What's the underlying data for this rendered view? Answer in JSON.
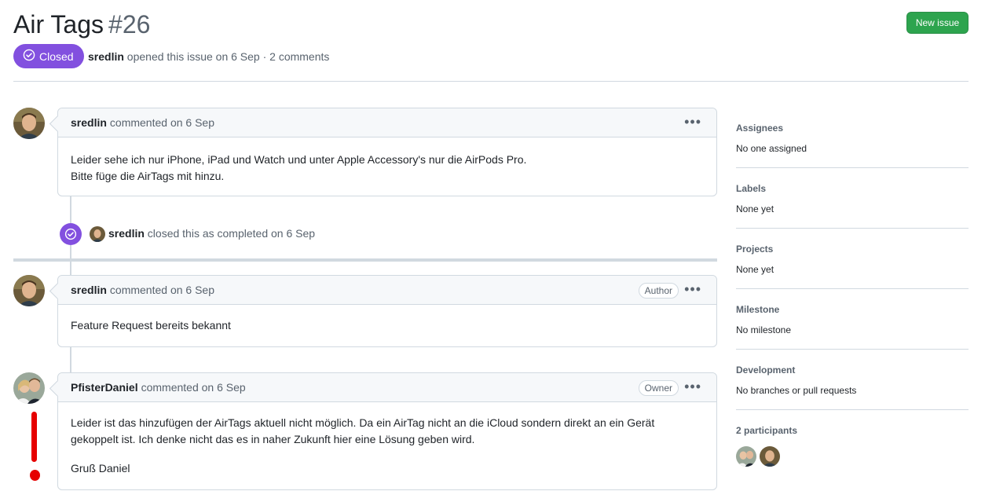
{
  "issue": {
    "title": "Air Tags",
    "number": "#26",
    "state": "Closed",
    "author": "sredlin",
    "opened_text": "opened this issue on 6 Sep · 2 comments"
  },
  "header": {
    "new_issue_label": "New issue"
  },
  "comments": [
    {
      "author": "sredlin",
      "action": "commented on 6 Sep",
      "role": "",
      "body": [
        "Leider sehe ich nur iPhone, iPad und Watch und unter Apple Accessory's nur die AirPods Pro.",
        "Bitte füge die AirTags mit hinzu."
      ]
    },
    {
      "author": "sredlin",
      "action": "commented on 6 Sep",
      "role": "Author",
      "body": [
        "Feature Request bereits bekannt"
      ]
    },
    {
      "author": "PfisterDaniel",
      "action": "commented on 6 Sep",
      "role": "Owner",
      "body": [
        "Leider ist das hinzufügen der AirTags aktuell nicht möglich. Da ein AirTag nicht an die iCloud sondern direkt an ein Gerät gekoppelt ist. Ich denke nicht das es in naher Zukunft hier eine Lösung geben wird.",
        "Gruß Daniel"
      ]
    }
  ],
  "event": {
    "actor": "sredlin",
    "text": "closed this as completed on 6 Sep"
  },
  "sidebar": {
    "sections": [
      {
        "heading": "Assignees",
        "value": "No one assigned"
      },
      {
        "heading": "Labels",
        "value": "None yet"
      },
      {
        "heading": "Projects",
        "value": "None yet"
      },
      {
        "heading": "Milestone",
        "value": "No milestone"
      },
      {
        "heading": "Development",
        "value": "No branches or pull requests"
      }
    ],
    "participants_label": "2 participants"
  },
  "colors": {
    "closed_purple": "#8250df",
    "new_issue_green": "#2da44e",
    "annotation_red": "#e60000"
  }
}
